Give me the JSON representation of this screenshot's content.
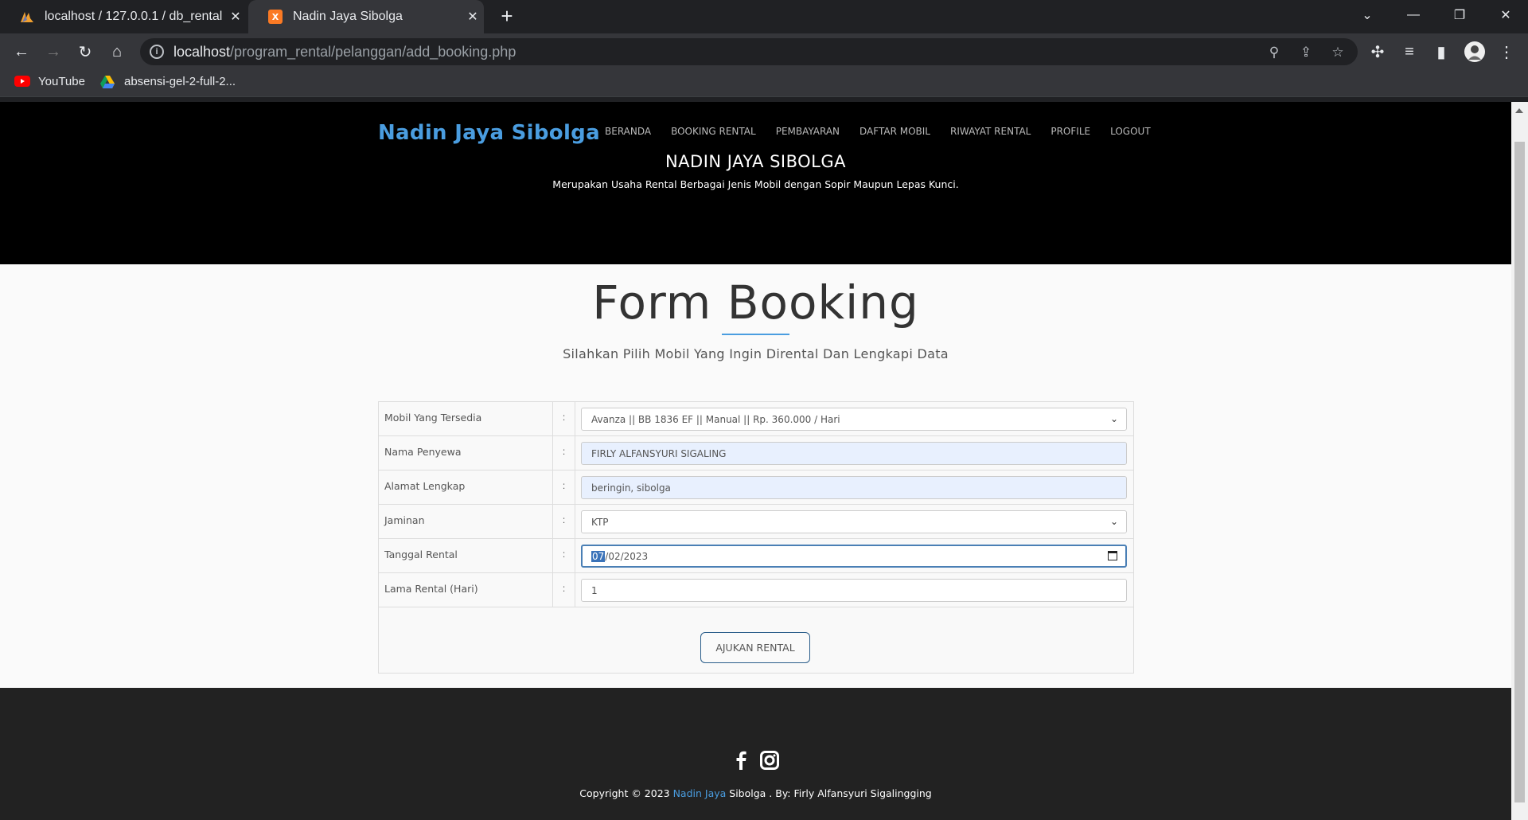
{
  "browser": {
    "tabs": [
      {
        "title": "localhost / 127.0.0.1 / db_rental /",
        "active": false
      },
      {
        "title": "Nadin Jaya Sibolga",
        "active": true
      }
    ],
    "url_host": "localhost",
    "url_path": "/program_rental/pelanggan/add_booking.php",
    "bookmarks": [
      "YouTube",
      "absensi-gel-2-full-2..."
    ]
  },
  "site": {
    "brand": "Nadin Jaya Sibolga",
    "nav": [
      "BERANDA",
      "BOOKING RENTAL",
      "PEMBAYARAN",
      "DAFTAR MOBIL",
      "RIWAYAT RENTAL",
      "PROFILE",
      "LOGOUT"
    ],
    "hero_title": "NADIN JAYA SIBOLGA",
    "hero_subtitle": "Merupakan Usaha Rental Berbagai Jenis Mobil dengan Sopir Maupun Lepas Kunci.",
    "accent_color": "#4a9de0"
  },
  "form": {
    "title": "Form Booking",
    "subtitle": "Silahkan Pilih Mobil Yang Ingin Dirental Dan Lengkapi Data",
    "rows": [
      {
        "label": "Mobil Yang Tersedia",
        "colon": ":",
        "value": "Avanza || BB 1836 EF || Manual || Rp. 360.000 / Hari",
        "type": "select"
      },
      {
        "label": "Nama Penyewa",
        "colon": ":",
        "value": "FIRLY ALFANSYURI SIGALING",
        "type": "text"
      },
      {
        "label": "Alamat Lengkap",
        "colon": ":",
        "value": "beringin, sibolga",
        "type": "text"
      },
      {
        "label": "Jaminan",
        "colon": ":",
        "value": "KTP",
        "type": "select"
      },
      {
        "label": "Tanggal Rental",
        "colon": ":",
        "value_day": "07",
        "value_rest": "/02/2023",
        "type": "date"
      },
      {
        "label": "Lama Rental (Hari)",
        "colon": ":",
        "value": "1",
        "type": "number"
      }
    ],
    "submit_label": "AJUKAN RENTAL"
  },
  "footer": {
    "copyright_prefix": "Copyright © 2023 ",
    "copyright_highlight": "Nadin Jaya",
    "copyright_suffix": " Sibolga . By: Firly Alfansyuri Sigalingging",
    "social_icons": [
      "facebook-icon",
      "instagram-icon"
    ]
  }
}
